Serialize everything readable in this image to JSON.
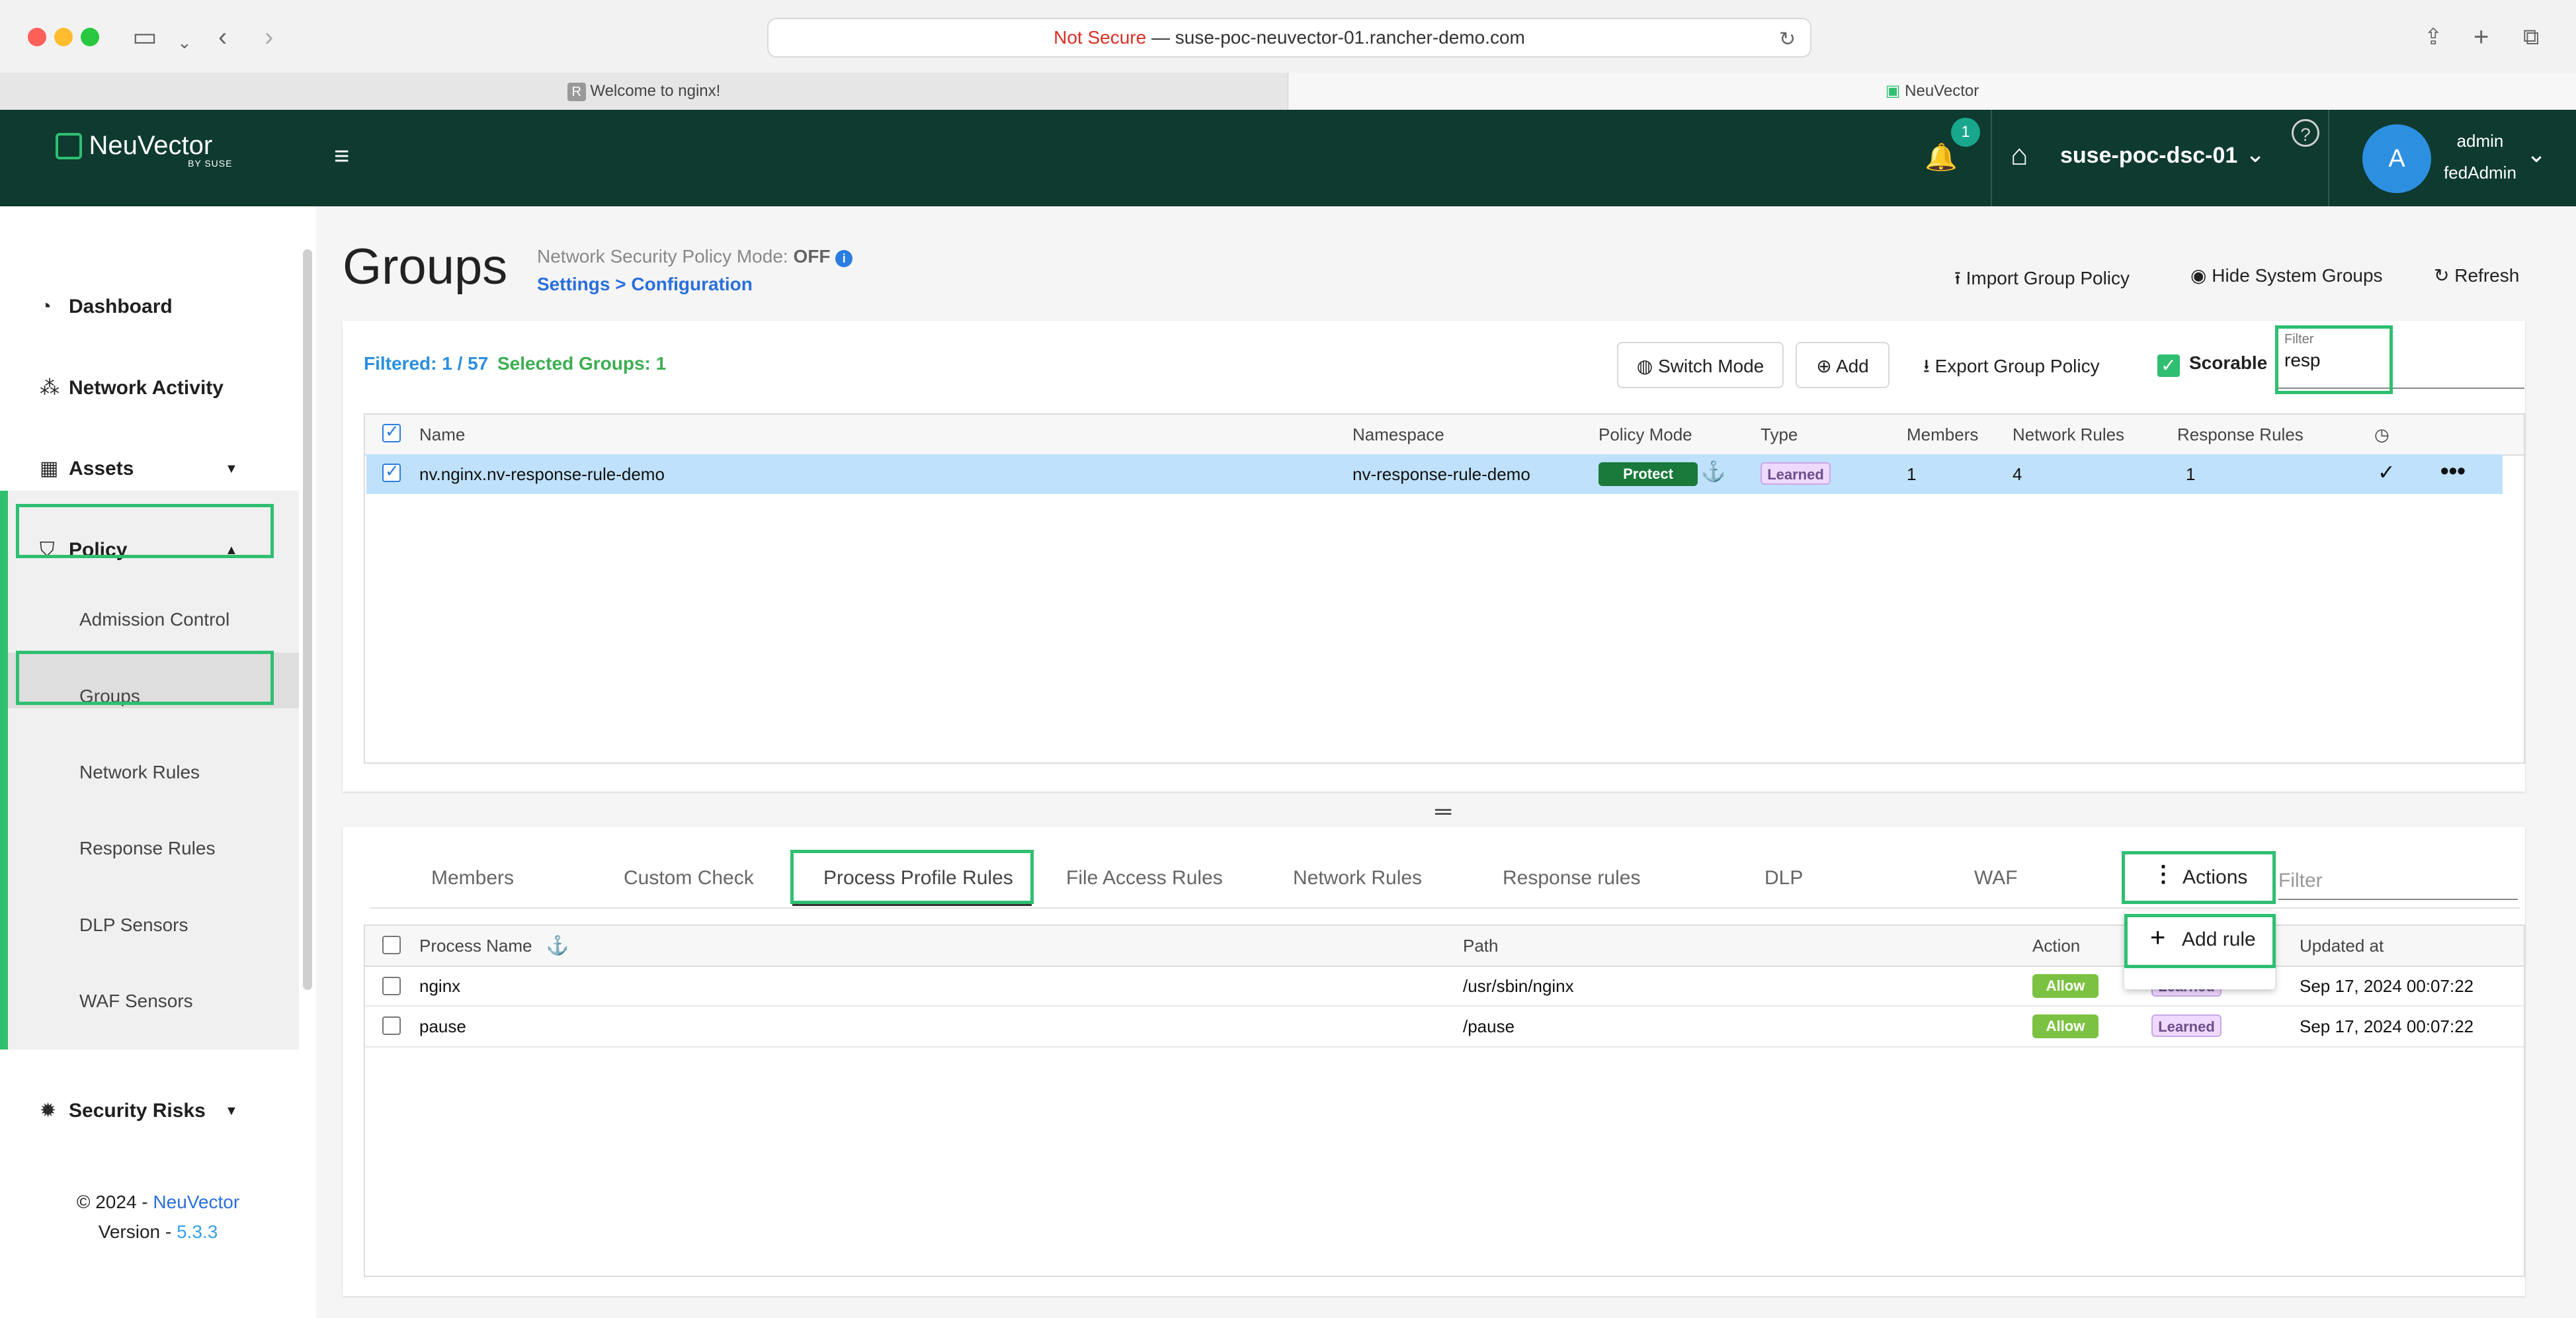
{
  "browser": {
    "url_prefix": "Not Secure",
    "url_rest": " — suse-poc-neuvector-01.rancher-demo.com",
    "tabs": [
      "Welcome to nginx!",
      "NeuVector"
    ]
  },
  "header": {
    "logo": "NeuVector",
    "logo_sub": "BY SUSE",
    "notifications": "1",
    "cluster": "suse-poc-dsc-01",
    "avatar": "A",
    "user": "admin",
    "role": "fedAdmin"
  },
  "sidebar": {
    "items": [
      "Dashboard",
      "Network Activity",
      "Assets",
      "Policy"
    ],
    "policy_sub": [
      "Admission Control",
      "Groups",
      "Network Rules",
      "Response Rules",
      "DLP Sensors",
      "WAF Sensors"
    ],
    "security_risks": "Security Risks",
    "footer_copy": "© 2024 - ",
    "footer_brand": "NeuVector",
    "footer_version_label": "Version - ",
    "footer_version": "5.3.3"
  },
  "page": {
    "title": "Groups",
    "nsp_label": "Network Security Policy Mode:",
    "nsp_value": "OFF",
    "settings_link": "Settings > Configuration",
    "import": "Import Group Policy",
    "hide": "Hide System Groups",
    "refresh": "Refresh"
  },
  "toolbar": {
    "filtered": "Filtered: 1 / 57",
    "selected": "Selected Groups:  1",
    "switch_mode": "Switch Mode",
    "add": "Add",
    "export": "Export Group Policy",
    "scorable": "Scorable",
    "filter_label": "Filter",
    "filter_value": "resp"
  },
  "groups_table": {
    "headers": [
      "Name",
      "Namespace",
      "Policy Mode",
      "Type",
      "Members",
      "Network Rules",
      "Response Rules"
    ],
    "row": {
      "name": "nv.nginx.nv-response-rule-demo",
      "namespace": "nv-response-rule-demo",
      "policy_mode": "Protect",
      "type": "Learned",
      "members": "1",
      "network_rules": "4",
      "response_rules": "1"
    }
  },
  "detail_tabs": [
    "Members",
    "Custom Check",
    "Process Profile Rules",
    "File Access Rules",
    "Network Rules",
    "Response rules",
    "DLP",
    "WAF"
  ],
  "actions": {
    "label": "Actions",
    "add_rule": "Add rule",
    "filter": "Filter"
  },
  "process_table": {
    "headers": [
      "Process Name",
      "Path",
      "Action",
      "Updated at"
    ],
    "rows": [
      {
        "name": "nginx",
        "path": "/usr/sbin/nginx",
        "action": "Allow",
        "type": "Learned",
        "updated": "Sep 17, 2024 00:07:22"
      },
      {
        "name": "pause",
        "path": "/pause",
        "action": "Allow",
        "type": "Learned",
        "updated": "Sep 17, 2024 00:07:22"
      }
    ]
  },
  "colors": {
    "brand": "#0e3a2f",
    "highlight": "#2fbf71",
    "link": "#2a6fdb",
    "protect": "#1a7a3c",
    "allow": "#7cc242"
  }
}
